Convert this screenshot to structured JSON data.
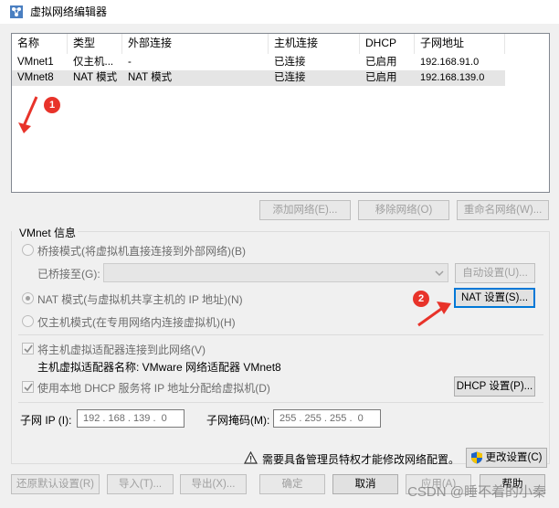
{
  "window": {
    "title": "虚拟网络编辑器"
  },
  "list": {
    "columns": [
      "名称",
      "类型",
      "外部连接",
      "主机连接",
      "DHCP",
      "子网地址"
    ],
    "rows": [
      {
        "name": "VMnet1",
        "type": "仅主机...",
        "external": "-",
        "host": "已连接",
        "dhcp": "已启用",
        "subnet": "192.168.91.0"
      },
      {
        "name": "VMnet8",
        "type": "NAT 模式",
        "external": "NAT 模式",
        "host": "已连接",
        "dhcp": "已启用",
        "subnet": "192.168.139.0"
      }
    ]
  },
  "list_buttons": {
    "add": "添加网络(E)...",
    "remove": "移除网络(O)",
    "rename": "重命名网络(W)..."
  },
  "vmnet_info": {
    "title": "VMnet 信息",
    "bridge_radio": "桥接模式(将虚拟机直接连接到外部网络)(B)",
    "bridged_to_label": "已桥接至(G):",
    "auto_settings": "自动设置(U)...",
    "nat_radio": "NAT 模式(与虚拟机共享主机的 IP 地址)(N)",
    "nat_settings": "NAT 设置(S)...",
    "hostonly_radio": "仅主机模式(在专用网络内连接虚拟机)(H)",
    "connect_adapter": "将主机虚拟适配器连接到此网络(V)",
    "adapter_name_label": "主机虚拟适配器名称: VMware 网络适配器 VMnet8",
    "use_dhcp": "使用本地 DHCP 服务将 IP 地址分配给虚拟机(D)",
    "dhcp_settings": "DHCP 设置(P)...",
    "subnet_ip_label": "子网 IP (I):",
    "subnet_ip_value": "192 . 168 . 139 .  0",
    "subnet_mask_label": "子网掩码(M):",
    "subnet_mask_value": "255 . 255 . 255 .  0"
  },
  "admin": {
    "notice": "需要具备管理员特权才能修改网络配置。",
    "change_settings": "更改设置(C)"
  },
  "footer": {
    "restore": "还原默认设置(R)",
    "import": "导入(T)...",
    "export": "导出(X)...",
    "ok": "确定",
    "cancel": "取消",
    "apply": "应用(A)",
    "help": "帮助"
  },
  "annotations": {
    "one": "1",
    "two": "2"
  },
  "watermark": "CSDN @睡不着的小秦",
  "colors": {
    "annotation": "#e8332a",
    "focus": "#0078d7",
    "shield_blue": "#1e64c8",
    "shield_yellow": "#f5c400"
  },
  "icons": [
    "network-editor-icon",
    "warning-icon",
    "shield-icon",
    "checkmark-icon",
    "dropdown-arrow-icon"
  ]
}
